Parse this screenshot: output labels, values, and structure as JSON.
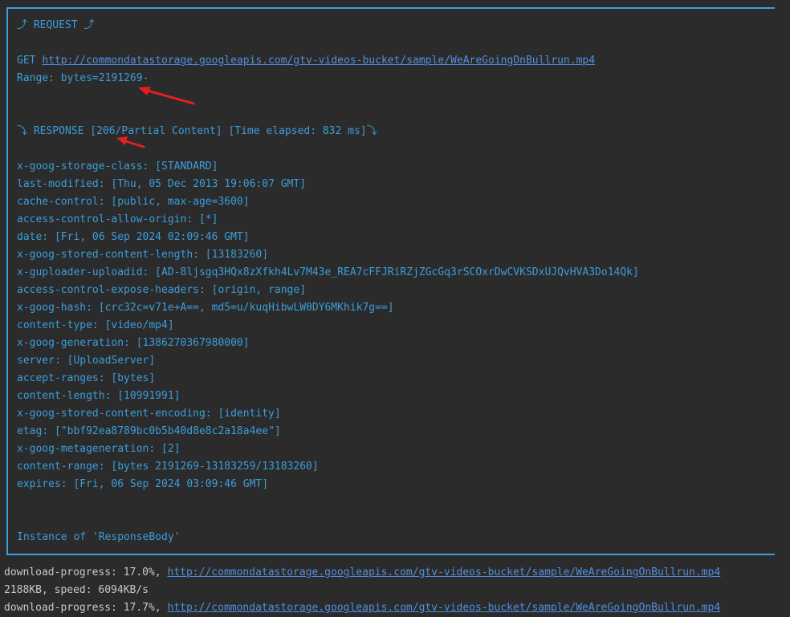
{
  "request": {
    "title": "⤴ REQUEST ⤴",
    "method": "GET",
    "url": "http://commondatastorage.googleapis.com/gtv-videos-bucket/sample/WeAreGoingOnBullrun.mp4",
    "range": "Range: bytes=2191269-"
  },
  "response": {
    "title": "⤵ RESPONSE [206/Partial Content] [Time elapsed: 832 ms]⤵",
    "headers": [
      "x-goog-storage-class: [STANDARD]",
      "last-modified: [Thu, 05 Dec 2013 19:06:07 GMT]",
      "cache-control: [public, max-age=3600]",
      "access-control-allow-origin: [*]",
      "date: [Fri, 06 Sep 2024 02:09:46 GMT]",
      "x-goog-stored-content-length: [13183260]",
      "x-guploader-uploadid: [AD-8ljsgq3HQx8zXfkh4Lv7M43e_REA7cFFJRiRZjZGcGq3rSCOxrDwCVKSDxUJQvHVA3Do14Qk]",
      "access-control-expose-headers: [origin, range]",
      "x-goog-hash: [crc32c=v71e+A==, md5=u/kuqHibwLW0DY6MKhik7g==]",
      "content-type: [video/mp4]",
      "x-goog-generation: [1386270367980000]",
      "server: [UploadServer]",
      "accept-ranges: [bytes]",
      "content-length: [10991991]",
      "x-goog-stored-content-encoding: [identity]",
      "etag: [\"bbf92ea8789bc0b5b40d8e8c2a18a4ee\"]",
      "x-goog-metageneration: [2]",
      "content-range: [bytes 2191269-13183259/13183260]",
      "expires: [Fri, 06 Sep 2024 03:09:46 GMT]"
    ],
    "body_note": "Instance of 'ResponseBody'"
  },
  "console": {
    "lines": [
      {
        "prefix": "download-progress: 17.0%, ",
        "url": "http://commondatastorage.googleapis.com/gtv-videos-bucket/sample/WeAreGoingOnBullrun.mp4"
      },
      {
        "prefix": "2188KB, speed: 6094KB/s",
        "url": ""
      },
      {
        "prefix": "download-progress: 17.7%, ",
        "url": "http://commondatastorage.googleapis.com/gtv-videos-bucket/sample/WeAreGoingOnBullrun.mp4"
      }
    ]
  },
  "annotation_color": "#e02020"
}
